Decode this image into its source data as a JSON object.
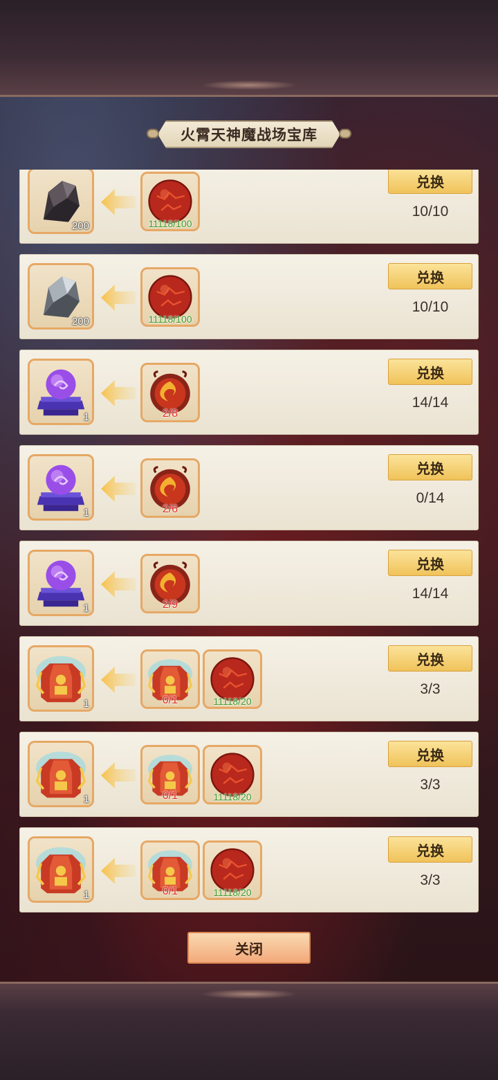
{
  "title": "火霄天神魔战场宝库",
  "exchange_label": "兑换",
  "close_label": "关闭",
  "rows": [
    {
      "target_icon": "black-ore-icon",
      "target_count": "200",
      "costs": [
        {
          "icon": "red-sphere-icon",
          "req": "11118/100",
          "req_color": "green"
        }
      ],
      "limit": "10/10"
    },
    {
      "target_icon": "silver-ore-icon",
      "target_count": "200",
      "costs": [
        {
          "icon": "red-sphere-icon",
          "req": "11118/100",
          "req_color": "green"
        }
      ],
      "limit": "10/10"
    },
    {
      "target_icon": "purple-orb-icon",
      "target_count": "1",
      "costs": [
        {
          "icon": "flame-token-icon",
          "req": "2/8",
          "req_color": "red"
        }
      ],
      "limit": "14/14"
    },
    {
      "target_icon": "purple-orb-icon",
      "target_count": "1",
      "costs": [
        {
          "icon": "flame-token-icon",
          "req": "2/6",
          "req_color": "red"
        }
      ],
      "limit": "0/14"
    },
    {
      "target_icon": "purple-orb-icon",
      "target_count": "1",
      "costs": [
        {
          "icon": "flame-token-icon",
          "req": "2/9",
          "req_color": "red"
        }
      ],
      "limit": "14/14"
    },
    {
      "target_icon": "armor-icon",
      "target_count": "1",
      "costs": [
        {
          "icon": "armor-icon",
          "req": "0/1",
          "req_color": "red"
        },
        {
          "icon": "red-sphere-icon",
          "req": "11118/20",
          "req_color": "green"
        }
      ],
      "limit": "3/3"
    },
    {
      "target_icon": "armor-icon",
      "target_count": "1",
      "costs": [
        {
          "icon": "armor-icon",
          "req": "0/1",
          "req_color": "red"
        },
        {
          "icon": "red-sphere-icon",
          "req": "11118/20",
          "req_color": "green"
        }
      ],
      "limit": "3/3"
    },
    {
      "target_icon": "armor-icon",
      "target_count": "1",
      "costs": [
        {
          "icon": "armor-icon",
          "req": "0/1",
          "req_color": "red"
        },
        {
          "icon": "red-sphere-icon",
          "req": "11118/20",
          "req_color": "green"
        }
      ],
      "limit": "3/3"
    }
  ]
}
